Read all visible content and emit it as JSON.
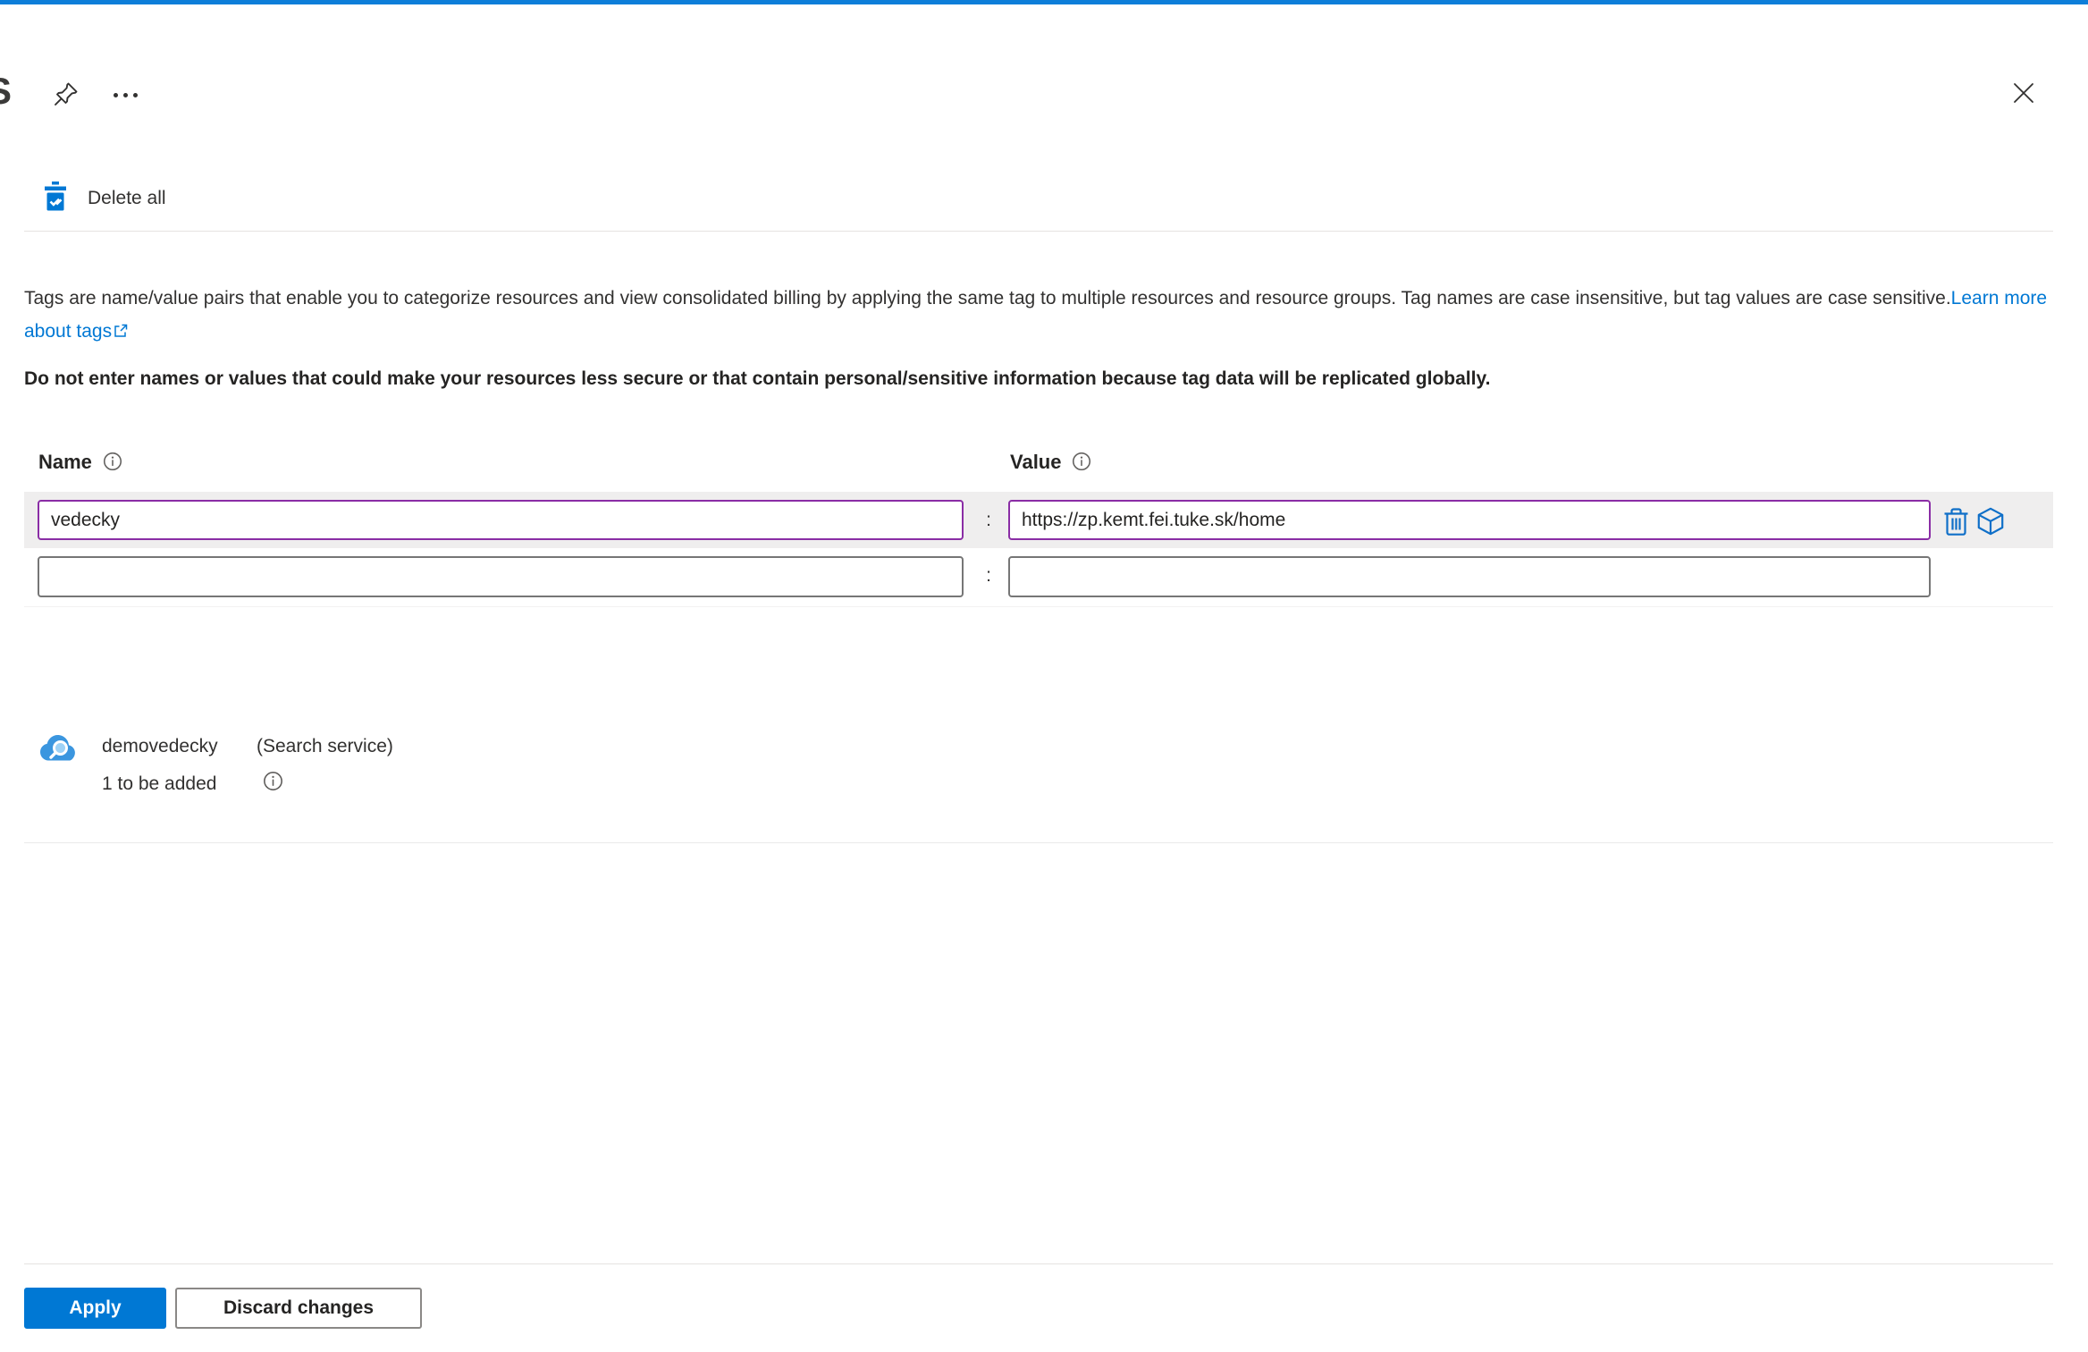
{
  "page": {
    "title_fragment": "S"
  },
  "toolbar": {
    "delete_all_label": "Delete all"
  },
  "intro": {
    "description": "Tags are name/value pairs that enable you to categorize resources and view consolidated billing by applying the same tag to multiple resources and resource groups. Tag names are case insensitive, but tag values are case sensitive.",
    "learn_more_label": "Learn more about tags",
    "warning": "Do not enter names or values that could make your resources less secure or that contain personal/sensitive information because tag data will be replicated globally."
  },
  "tags_table": {
    "name_header": "Name",
    "value_header": "Value",
    "separator": ":",
    "rows": [
      {
        "name": "vedecky",
        "value": "https://zp.kemt.fei.tuke.sk/home",
        "modified": true
      },
      {
        "name": "",
        "value": "",
        "modified": false
      }
    ]
  },
  "resource_summary": {
    "resource_name": "demovedecky",
    "resource_type": "(Search service)",
    "pending_changes": "1 to be added"
  },
  "footer": {
    "apply_label": "Apply",
    "discard_label": "Discard changes"
  },
  "icons": {
    "pin": "pin-icon",
    "more": "more-icon",
    "close": "close-icon",
    "delete_all": "delete-all-checked-trash-icon",
    "external_link": "external-link-icon",
    "info": "info-icon",
    "delete_row": "trash-icon",
    "resource": "cube-icon",
    "search_service": "search-service-cloud-icon"
  },
  "colors": {
    "accent": "#0078d4",
    "top_bar": "#0d7ed9",
    "modified_field_border": "#8a2da5",
    "default_field_border": "#767676",
    "row_highlight": "#efeeee",
    "text": "#323130"
  }
}
